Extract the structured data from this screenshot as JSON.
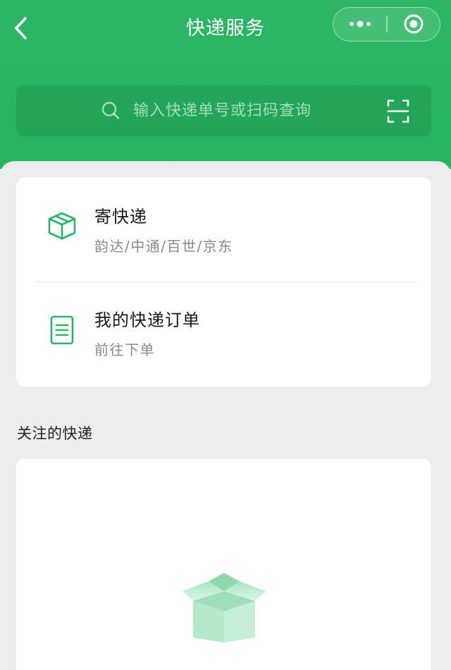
{
  "header": {
    "title": "快递服务"
  },
  "search": {
    "placeholder": "输入快递单号或扫码查询"
  },
  "services": [
    {
      "label": "寄快递",
      "subtitle": "韵达/中通/百世/京东",
      "icon": "package-icon"
    },
    {
      "label": "我的快递订单",
      "subtitle": "前往下单",
      "icon": "document-icon"
    }
  ],
  "followed": {
    "title": "关注的快递",
    "empty_icon": "empty-box-icon"
  },
  "colors": {
    "header_green": "#2db565",
    "accent_green": "#2bb36a",
    "background": "#ededed"
  }
}
